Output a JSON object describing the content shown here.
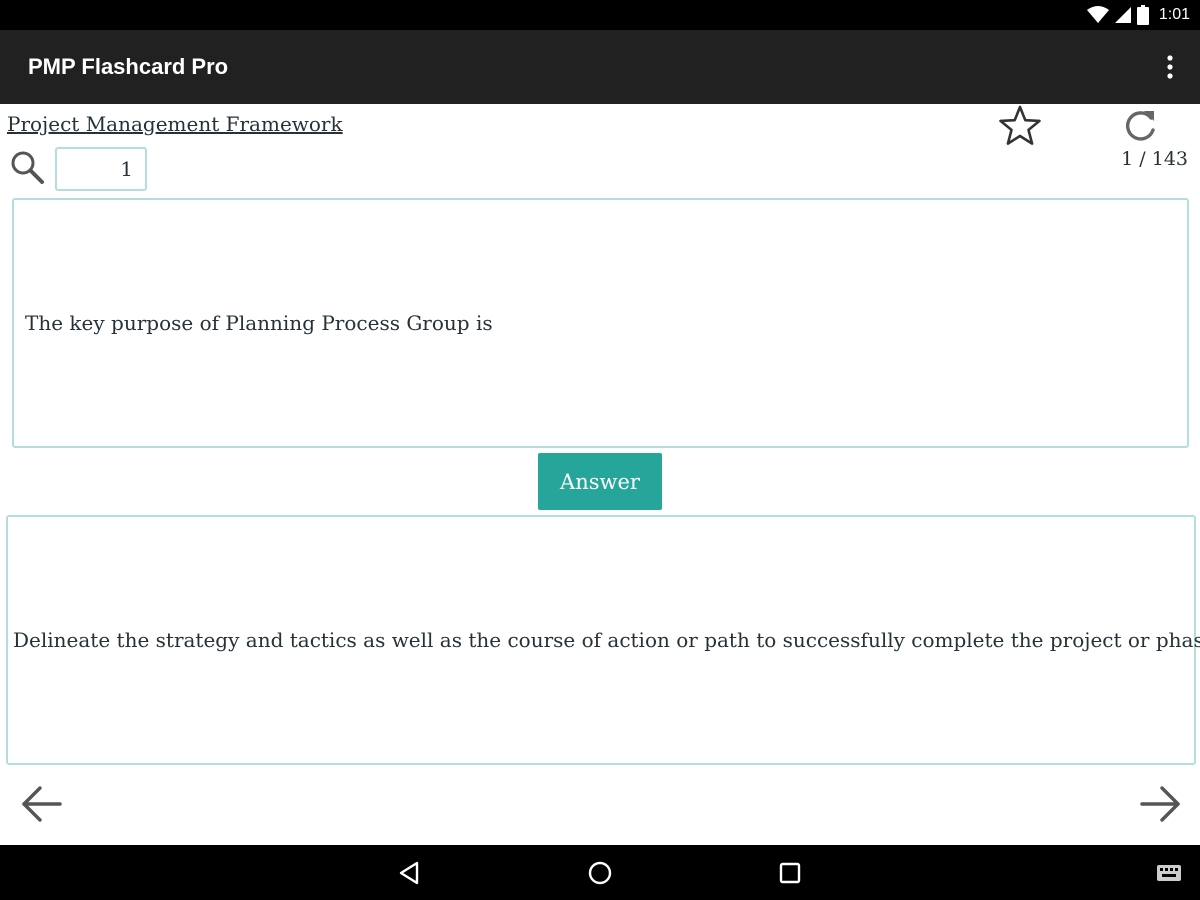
{
  "status_bar": {
    "time": "1:01",
    "icons": [
      "wifi-icon",
      "cell-signal-icon",
      "battery-icon"
    ]
  },
  "app_bar": {
    "title": "PMP Flashcard Pro",
    "menu_icon": "overflow-menu-icon"
  },
  "card": {
    "category": "Project Management Framework",
    "card_number": "1",
    "counter": "1 / 143",
    "question": "The key purpose of Planning Process Group is",
    "answer_button": "Answer",
    "answer": "Delineate the strategy and tactics as well as the course of action or path to successfully complete the project or phase"
  },
  "icons": {
    "favorite": "star-outline-icon",
    "reset": "refresh-icon",
    "search": "search-icon",
    "previous": "arrow-left-icon",
    "next": "arrow-right-icon"
  },
  "nav_bar": {
    "icons": [
      "back-icon",
      "home-icon",
      "recents-icon",
      "keyboard-icon"
    ]
  },
  "colors": {
    "app_bar": "#212121",
    "accent": "#26a69a",
    "border": "#b2dfdb",
    "text": "#263238"
  }
}
